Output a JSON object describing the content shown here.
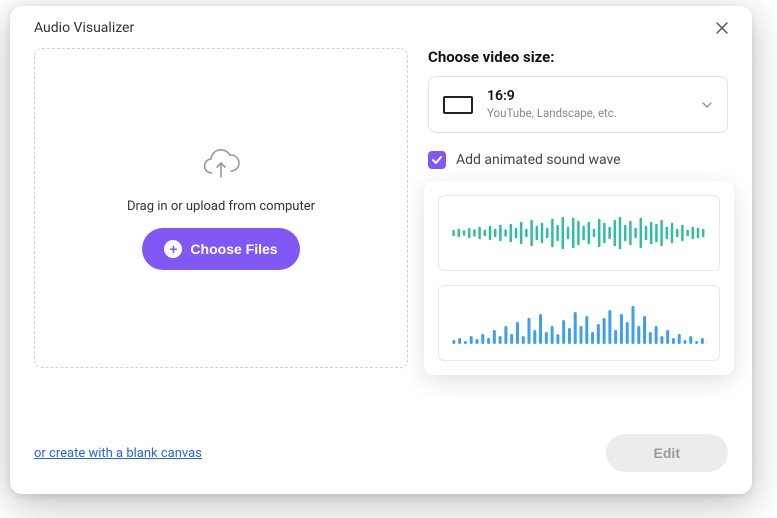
{
  "header": {
    "title": "Audio Visualizer"
  },
  "dropzone": {
    "text": "Drag in or upload from computer",
    "choose_label": "Choose Files"
  },
  "right": {
    "choose_size_label": "Choose video size:",
    "ratio": {
      "title": "16:9",
      "subtitle": "YouTube, Landscape, etc."
    },
    "sound_wave_checkbox_label": "Add animated sound wave",
    "sound_wave_checked": true
  },
  "footer": {
    "blank_canvas": "or create with a blank canvas",
    "edit_label": "Edit"
  },
  "waves": {
    "green_color": "#2fbf9a",
    "blue_color": "#3da0ef",
    "green_heights": [
      4,
      6,
      3,
      8,
      5,
      10,
      4,
      12,
      6,
      14,
      5,
      16,
      8,
      20,
      6,
      24,
      12,
      18,
      8,
      26,
      14,
      30,
      10,
      28,
      22,
      12,
      20,
      6,
      26,
      18,
      10,
      24,
      30,
      14,
      22,
      8,
      28,
      12,
      20,
      16,
      24,
      10,
      18,
      6,
      14,
      4,
      10,
      8,
      6,
      4
    ],
    "blue_heights": [
      4,
      6,
      3,
      8,
      5,
      10,
      6,
      14,
      8,
      18,
      10,
      22,
      8,
      26,
      14,
      30,
      12,
      18,
      10,
      24,
      16,
      32,
      18,
      28,
      12,
      20,
      26,
      34,
      14,
      30,
      22,
      38,
      18,
      28,
      12,
      18,
      8,
      14,
      6,
      10,
      4,
      8,
      3,
      6,
      4
    ]
  }
}
